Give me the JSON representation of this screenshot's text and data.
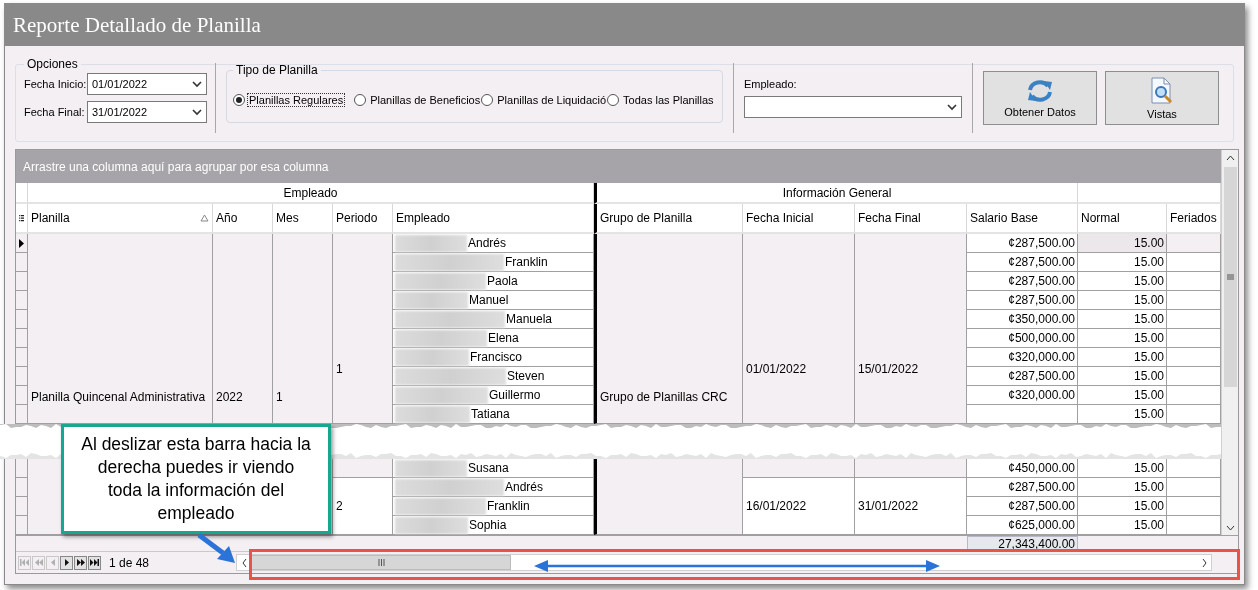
{
  "window": {
    "title": "Reporte Detallado de Planilla"
  },
  "options": {
    "legend": "Opciones",
    "dates": [
      {
        "label": "Fecha Inicio:",
        "value": "01/01/2022"
      },
      {
        "label": "Fecha Final:",
        "value": "31/01/2022"
      }
    ],
    "tipo_planilla": {
      "legend": "Tipo de Planilla",
      "options": [
        {
          "label": "Planillas Regulares",
          "selected": true
        },
        {
          "label": "Planillas de Beneficios",
          "selected": false
        },
        {
          "label": "Planillas de Liquidació",
          "selected": false
        },
        {
          "label": "Todas las Planillas",
          "selected": false
        }
      ]
    },
    "empleado": {
      "label": "Empleado:"
    },
    "buttons": [
      {
        "label": "Obtener Datos",
        "kind": "refresh"
      },
      {
        "label": "Vistas",
        "kind": "preview"
      }
    ]
  },
  "grid": {
    "group_panel": "Arrastre una columna aquí para agrupar por esa columna",
    "bands": [
      {
        "label": "Empleado"
      },
      {
        "label": "Información General"
      }
    ],
    "columns": [
      {
        "label": "Planilla",
        "sorted": true
      },
      {
        "label": "Año",
        "sorted": false
      },
      {
        "label": "Mes",
        "sorted": false
      },
      {
        "label": "Periodo",
        "sorted": false
      },
      {
        "label": "Empleado",
        "sorted": false
      },
      {
        "label": "Grupo de Planilla",
        "sorted": false
      },
      {
        "label": "Fecha Inicial",
        "sorted": false
      },
      {
        "label": "Fecha Final",
        "sorted": false
      },
      {
        "label": "Salario Base",
        "sorted": false
      },
      {
        "label": "Normal",
        "sorted": false
      },
      {
        "label": "Feriados",
        "sorted": false
      }
    ],
    "segments": [
      {
        "planilla": "Planilla Quincenal Administrativa",
        "anio": "2022",
        "mes": "1",
        "grupo": "Grupo de Planillas CRC",
        "periods": [
          {
            "periodo": "1",
            "fecha_inicial": "01/01/2022",
            "fecha_final": "15/01/2022",
            "rows": [
              {
                "empleado": "Andrés",
                "salario_base": "¢287,500.00",
                "normal": "15.00",
                "current": true
              },
              {
                "empleado": "Franklin",
                "salario_base": "¢287,500.00",
                "normal": "15.00",
                "current": false
              },
              {
                "empleado": "Paola",
                "salario_base": "¢287,500.00",
                "normal": "15.00",
                "current": false
              },
              {
                "empleado": "Manuel",
                "salario_base": "¢287,500.00",
                "normal": "15.00",
                "current": false
              },
              {
                "empleado": "Manuela",
                "salario_base": "¢350,000.00",
                "normal": "15.00",
                "current": false
              },
              {
                "empleado": "Elena",
                "salario_base": "¢500,000.00",
                "normal": "15.00",
                "current": false
              },
              {
                "empleado": "Francisco",
                "salario_base": "¢320,000.00",
                "normal": "15.00",
                "current": false
              },
              {
                "empleado": "Steven",
                "salario_base": "¢287,500.00",
                "normal": "15.00",
                "current": false
              },
              {
                "empleado": "Guillermo",
                "salario_base": "¢320,000.00",
                "normal": "15.00",
                "current": false
              },
              {
                "empleado": "Tatiana",
                "normal": "15.00",
                "current": false
              }
            ]
          }
        ]
      },
      {
        "periods": [
          {
            "rows": [
              {
                "empleado": "Susana",
                "salario_base": "¢450,000.00",
                "normal": "15.00",
                "current": false
              }
            ]
          },
          {
            "periodo": "2",
            "fecha_inicial": "16/01/2022",
            "fecha_final": "31/01/2022",
            "rows": [
              {
                "empleado": "Andrés",
                "salario_base": "¢287,500.00",
                "normal": "15.00",
                "current": false
              },
              {
                "empleado": "Franklin",
                "salario_base": "¢287,500.00",
                "normal": "15.00",
                "current": false
              },
              {
                "empleado": "Sophia",
                "salario_base": "¢625,000.00",
                "normal": "15.00",
                "current": false
              }
            ]
          }
        ]
      }
    ],
    "total": "27,343,400.00",
    "pager": {
      "text": "1 de 48",
      "buttons": [
        {
          "kind": "first",
          "disabled": true
        },
        {
          "kind": "prev_page",
          "disabled": true
        },
        {
          "kind": "prev",
          "disabled": true
        },
        {
          "kind": "next",
          "disabled": false
        },
        {
          "kind": "next_page",
          "disabled": false
        },
        {
          "kind": "last",
          "disabled": false
        }
      ]
    }
  },
  "callout": {
    "text": "Al deslizar esta barra hacia la derecha puedes ir viendo toda la información del empleado"
  }
}
